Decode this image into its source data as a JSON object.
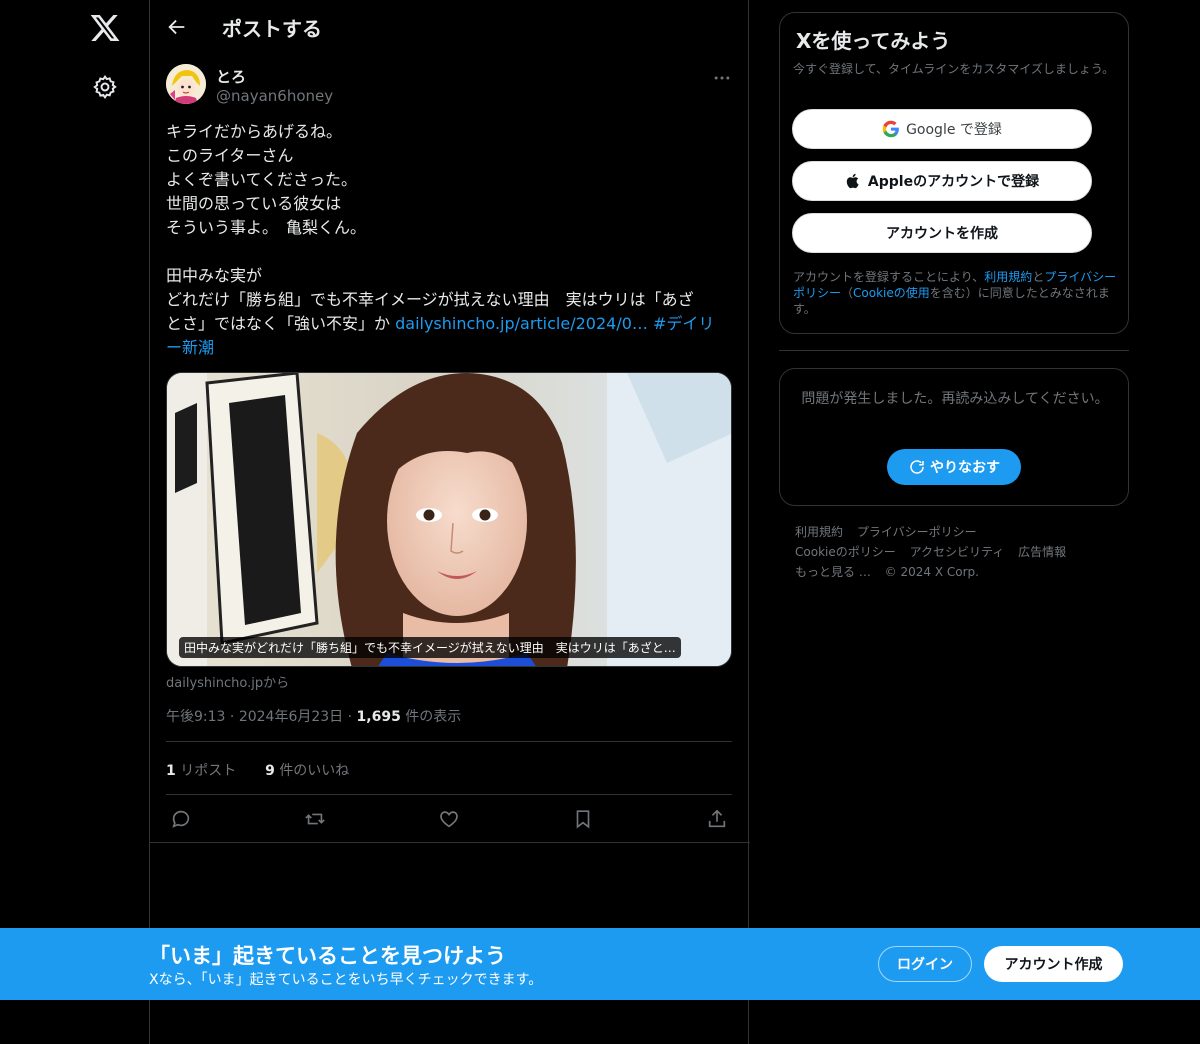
{
  "header": {
    "title": "ポストする"
  },
  "post": {
    "display_name": "とろ",
    "handle": "@nayan6honey",
    "lines": [
      "キライだからあげるね。",
      "このライターさん",
      "よくぞ書いてくださった。",
      "世間の思っている彼女は",
      "そういう事よ。　亀梨くん。",
      "",
      "田中みな実が",
      "どれだけ「勝ち組」でも不幸イメージが拭えない理由　実はウリは「あざ",
      "とさ」ではなく「強い不安」か"
    ],
    "link_text": "dailyshincho.jp/article/2024/0…",
    "hashtag_part1": "#デイリ",
    "hashtag_part2": "ー新潮",
    "card_caption": "田中みな実がどれだけ「勝ち組」でも不幸イメージが拭えない理由　実はウリは「あざと…",
    "card_source": "dailyshincho.jpから",
    "time": "午後9:13",
    "date": "2024年6月23日",
    "views_count": "1,695",
    "views_label": "件の表示",
    "reposts_count": "1",
    "reposts_label": "リポスト",
    "likes_count": "9",
    "likes_label": "件のいいね"
  },
  "signup": {
    "title": "Xを使ってみよう",
    "subtitle": "今すぐ登録して、タイムラインをカスタマイズしましょう。",
    "google_label": "Google で登録",
    "apple_label": "Appleのアカウントで登録",
    "create_label": "アカウントを作成",
    "legal_prefix": "アカウントを登録することにより、",
    "legal_terms": "利用規約",
    "legal_and": "と",
    "legal_privacy": "プライバシーポリシー",
    "legal_paren_open": "（",
    "legal_cookie": "Cookieの使用",
    "legal_suffix": "を含む）に同意したとみなされます。"
  },
  "error": {
    "message": "問題が発生しました。再読み込みしてください。",
    "retry_label": "やりなおす"
  },
  "footer": {
    "terms": "利用規約",
    "privacy": "プライバシーポリシー",
    "cookie": "Cookieのポリシー",
    "accessibility": "アクセシビリティ",
    "ads": "広告情報",
    "more": "もっと見る …",
    "copyright": "© 2024 X Corp."
  },
  "banner": {
    "heading": "「いま」起きていることを見つけよう",
    "subtext": "Xなら、「いま」起きていることをいち早くチェックできます。",
    "login_label": "ログイン",
    "create_label": "アカウント作成"
  },
  "colors": {
    "accent": "#1d9bf0",
    "background": "#000000",
    "border": "#2f3336",
    "muted_text": "#71767b"
  }
}
